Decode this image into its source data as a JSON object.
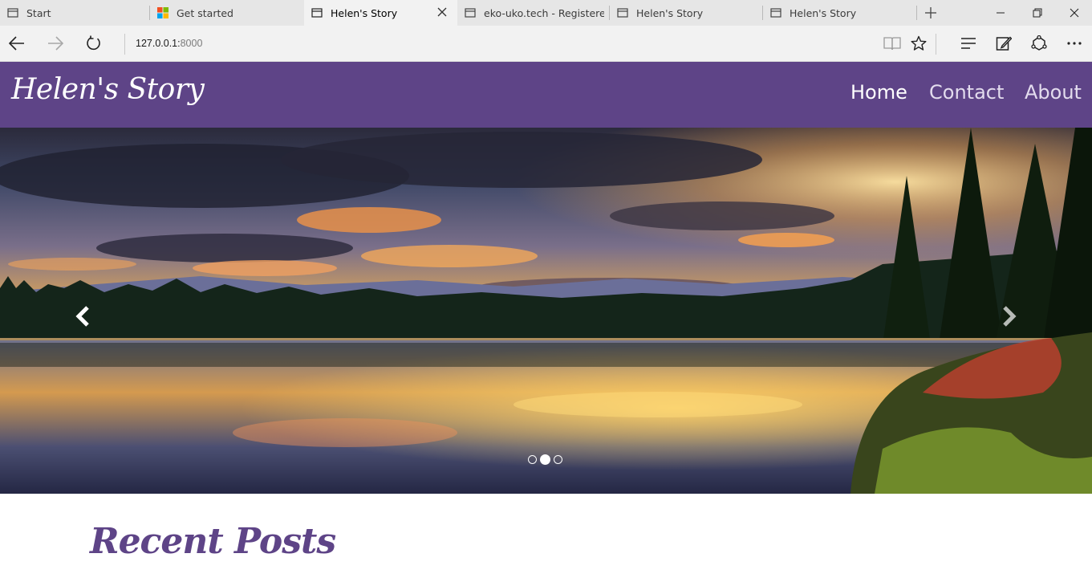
{
  "browser": {
    "tabs": [
      {
        "label": "Start",
        "icon": "page-icon",
        "active": false
      },
      {
        "label": "Get started",
        "icon": "windows-logo-icon",
        "active": false
      },
      {
        "label": "Helen's Story",
        "icon": "page-icon",
        "active": true
      },
      {
        "label": "eko-uko.tech - Registered a",
        "icon": "page-icon",
        "active": false
      },
      {
        "label": "Helen's Story",
        "icon": "page-icon",
        "active": false
      },
      {
        "label": "Helen's Story",
        "icon": "page-icon",
        "active": false
      }
    ],
    "address": {
      "host": "127.0.0.1:",
      "port": "8000"
    }
  },
  "site": {
    "brand": "Helen's Story",
    "nav": [
      {
        "label": "Home",
        "current": true
      },
      {
        "label": "Contact",
        "current": false
      },
      {
        "label": "About",
        "current": false
      }
    ],
    "colors": {
      "primary": "#5e4487",
      "nav_text": "#e3dcee",
      "heading": "#5e4487"
    }
  },
  "carousel": {
    "slide_count": 3,
    "active_index": 1,
    "prev_icon": "chevron-left-icon",
    "next_icon": "chevron-right-icon",
    "image": "lake-sunset-landscape"
  },
  "recent_posts": {
    "title": "Recent Posts"
  }
}
